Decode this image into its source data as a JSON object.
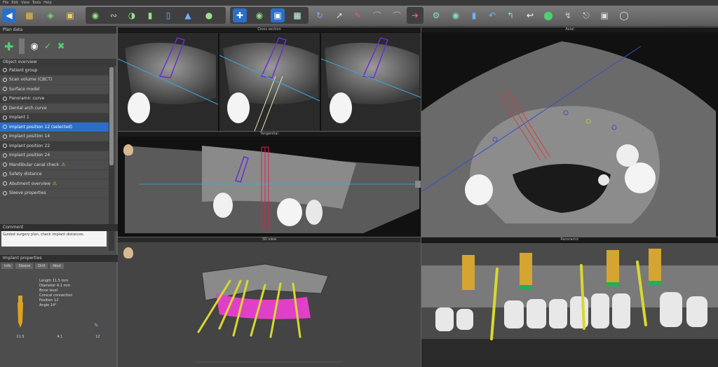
{
  "menu": [
    "File",
    "Edit",
    "View",
    "Tools",
    "Help"
  ],
  "toolbar": {
    "icons": [
      "back-icon",
      "folder-icon",
      "layers-icon",
      "implant-library-icon",
      "dentition-icon",
      "nerve-icon",
      "sinus-icon",
      "implant-icon",
      "abutment-icon",
      "cross-icon",
      "circle-icon",
      "view-3d-icon",
      "grid-icon",
      "rotate-icon",
      "slope-icon",
      "pen-icon",
      "curve-icon",
      "measure-icon",
      "settings-icon",
      "tooth-icon",
      "cut-icon",
      "marker-icon",
      "shape-icon",
      "sphere-icon",
      "hook-icon",
      "pin-icon",
      "image-icon",
      "shield-icon"
    ]
  },
  "left_panel": {
    "title": "Plan data",
    "object_list_title": "Object overview",
    "rows": [
      {
        "label": "Patient group",
        "type": "group"
      },
      {
        "label": "Scan volume (CBCT)",
        "type": "item"
      },
      {
        "label": "Surface model",
        "type": "item"
      },
      {
        "label": "Panoramic curve",
        "type": "group"
      },
      {
        "label": "Dental arch curve",
        "type": "item"
      },
      {
        "label": "Implant 1",
        "type": "group"
      },
      {
        "label": "Implant position 12 (selected)",
        "type": "selected"
      },
      {
        "label": "Implant position 14",
        "type": "item"
      },
      {
        "label": "Implant position 22",
        "type": "group"
      },
      {
        "label": "Implant position 24",
        "type": "item"
      },
      {
        "label": "Mandibular canal check",
        "type": "warn"
      },
      {
        "label": "Safety distance",
        "type": "item"
      },
      {
        "label": "Abutment overview",
        "type": "warn"
      },
      {
        "label": "Sleeve properties",
        "type": "item"
      }
    ],
    "note_title": "Comment",
    "note_text": "Guided surgery plan, check implant distances.",
    "properties_title": "Implant properties",
    "tabs": [
      "Info",
      "Sleeve",
      "Drill",
      "Abut"
    ],
    "prop_lines": [
      "Length 11.5 mm",
      "Diameter 4.1 mm",
      "Bone level",
      "Conical connection",
      "Position 12",
      "Angle 14°"
    ],
    "footer_values": [
      "11.5",
      "4.1",
      "12"
    ]
  },
  "views": {
    "cross_header": "Cross section",
    "tangential_header": "Tangential",
    "axial_header": "Axial",
    "render3d_header": "3D view",
    "panoramic_header": "Panoramic"
  },
  "colors": {
    "accent": "#2c6ec7",
    "warning": "#f2cf2b",
    "implant_gold": "#d4a531",
    "implant_green": "#1fb05a",
    "guide_magenta": "#e040c8"
  }
}
